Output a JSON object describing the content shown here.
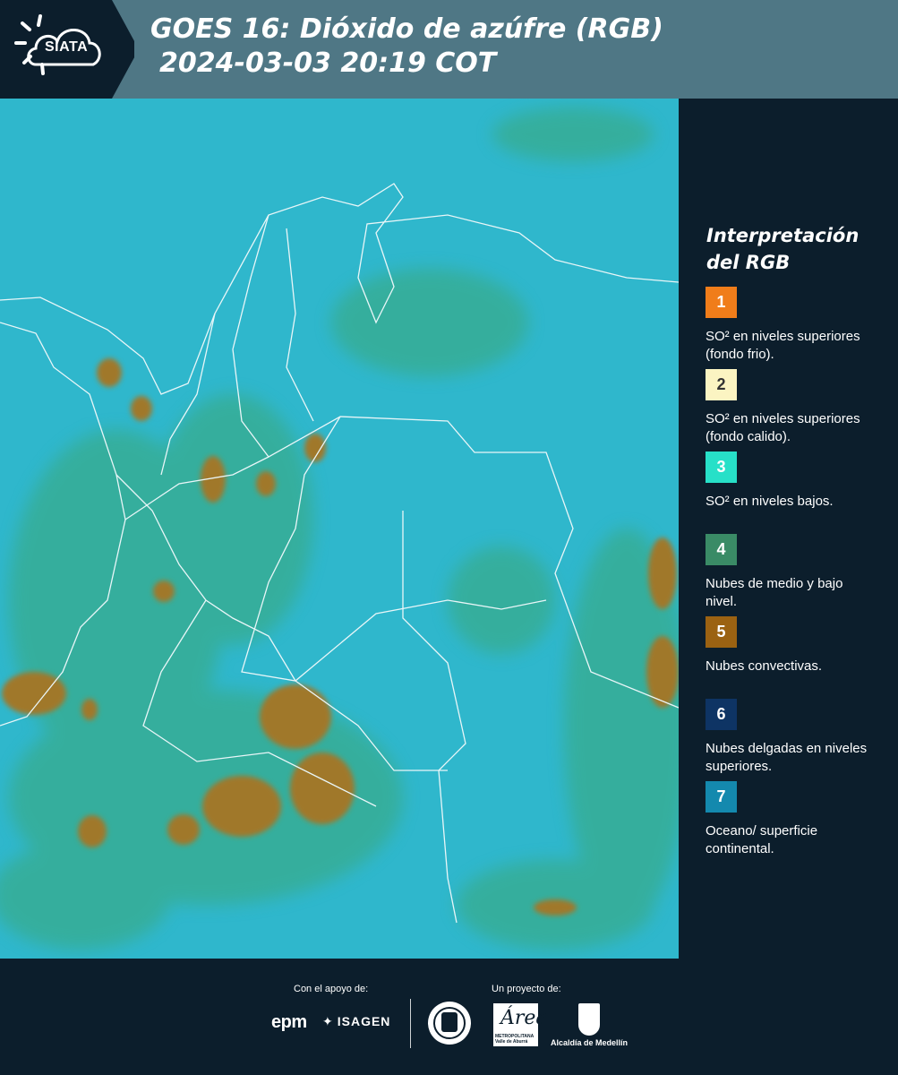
{
  "header": {
    "logo": "SIATA",
    "title_line1": "GOES 16: Dióxido de azúfre (RGB)",
    "title_line2": "2024-03-03 20:19 COT"
  },
  "map": {
    "base_color": "#2fb7cc",
    "land_color": "#3aa878",
    "cloud_color": "#a0782a",
    "border_color": "#e9f6f8"
  },
  "legend": {
    "title": "Interpretación del RGB",
    "items": [
      {
        "number": "1",
        "color": "#f07d1a",
        "label": "SO² en niveles superiores (fondo frio)."
      },
      {
        "number": "2",
        "color": "#fbf4c2",
        "label": "SO² en niveles superiores (fondo calido)."
      },
      {
        "number": "3",
        "color": "#27e0c8",
        "label": "SO² en niveles bajos."
      },
      {
        "number": "4",
        "color": "#3a8b66",
        "label": "Nubes de medio y bajo nivel."
      },
      {
        "number": "5",
        "color": "#9b6212",
        "label": "Nubes convectivas."
      },
      {
        "number": "6",
        "color": "#0e3464",
        "label": "Nubes delgadas en niveles superiores."
      },
      {
        "number": "7",
        "color": "#1489ae",
        "label": "Oceano/ superficie continental."
      }
    ]
  },
  "footer": {
    "support_label": "Con el apoyo de:",
    "project_label": "Un proyecto de:",
    "sponsor_1": "epm",
    "sponsor_2": "ISAGEN",
    "partner_area": "Área",
    "partner_area_sub": "METROPOLITANA Valle de Aburrá",
    "partner_alcaldia": "Alcaldía de Medellín"
  }
}
